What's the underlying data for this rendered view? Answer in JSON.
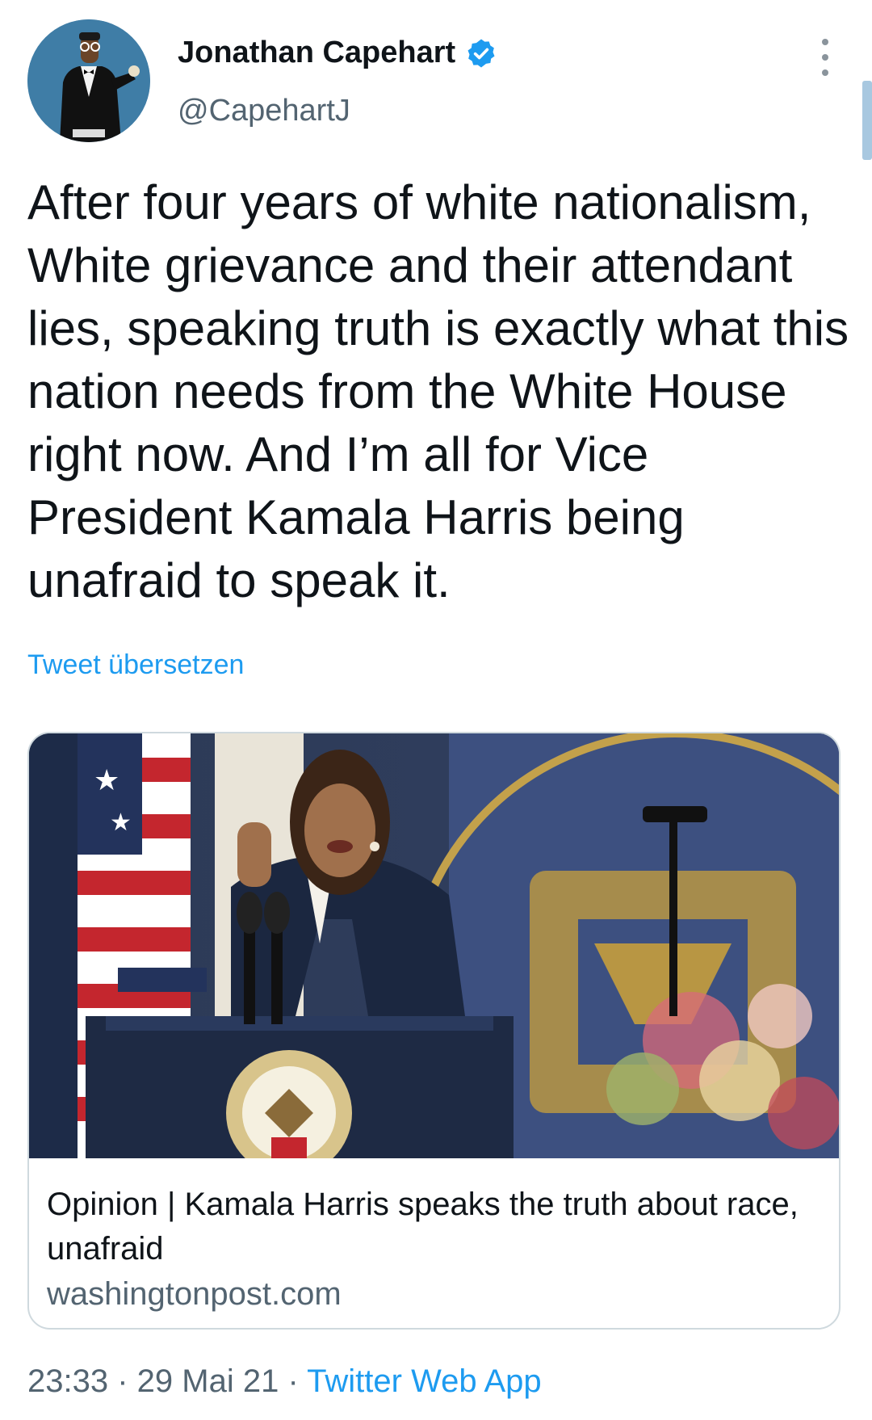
{
  "author": {
    "name": "Jonathan Capehart",
    "handle": "@CapehartJ"
  },
  "tweet": {
    "text": "After four years of white nationalism, White grievance and their attendant lies, speaking truth is exactly what this nation needs from the White House right now. And I’m all for Vice President Kamala Harris being unafraid to speak it.",
    "translate_label": "Tweet übersetzen"
  },
  "link_card": {
    "title": "Opinion | Kamala Harris speaks the truth about race, unafraid",
    "domain": "washingtonpost.com"
  },
  "meta": {
    "time": "23:33",
    "separator": " · ",
    "date": "29 Mai 21",
    "source": "Twitter Web App"
  },
  "colors": {
    "accent": "#1d9bf0",
    "secondary_text": "#536471",
    "border": "#cfd9de"
  },
  "icons": [
    "verified-badge-icon",
    "more-options-icon"
  ]
}
